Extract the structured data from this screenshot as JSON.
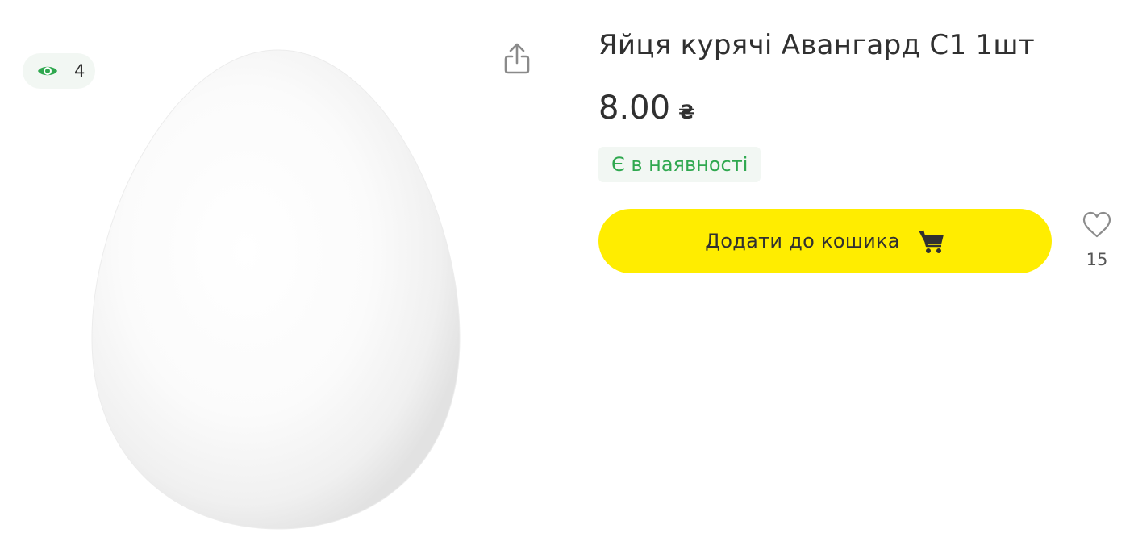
{
  "product": {
    "title": "Яйця курячі Авангард С1 1шт",
    "price": "8.00",
    "currency": "₴",
    "stock_status": "Є в наявності",
    "views": "4",
    "favorites": "15",
    "image_alt": "egg"
  },
  "actions": {
    "add_to_cart_label": "Додати до кошика"
  },
  "icons": {
    "views": "eye-icon",
    "share": "share-icon",
    "cart": "cart-icon",
    "favorite": "heart-icon"
  },
  "colors": {
    "accent_yellow": "#ffed00",
    "stock_green": "#2fa84f",
    "badge_bg": "#f2f7f3",
    "text": "#303030"
  }
}
